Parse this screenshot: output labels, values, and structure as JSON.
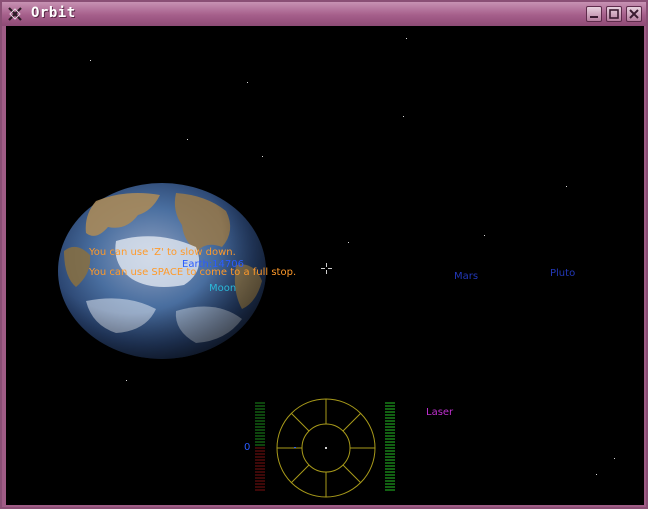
{
  "window": {
    "title": "Orbit",
    "buttons": {
      "minimize": "minimize",
      "maximize": "maximize",
      "close": "close"
    }
  },
  "messages": [
    "You can use 'Z' to slow down.",
    "You can use SPACE to come to a full stop."
  ],
  "targets": {
    "earth": "Earth:14706",
    "moon": "Moon",
    "mars": "Mars",
    "pluto": "Pluto"
  },
  "hud": {
    "weapon": "Laser",
    "speed": "0",
    "colors": {
      "message": "#ff9a2a",
      "earth_label": "#2a5cff",
      "moon_label": "#2ab8d8",
      "planet_label": "#2238b8",
      "weapon_label": "#c030d0",
      "radar": "#a89a1a",
      "shield_bar": "#1a8a1a",
      "speed_bar_low": "#7a1010"
    }
  }
}
